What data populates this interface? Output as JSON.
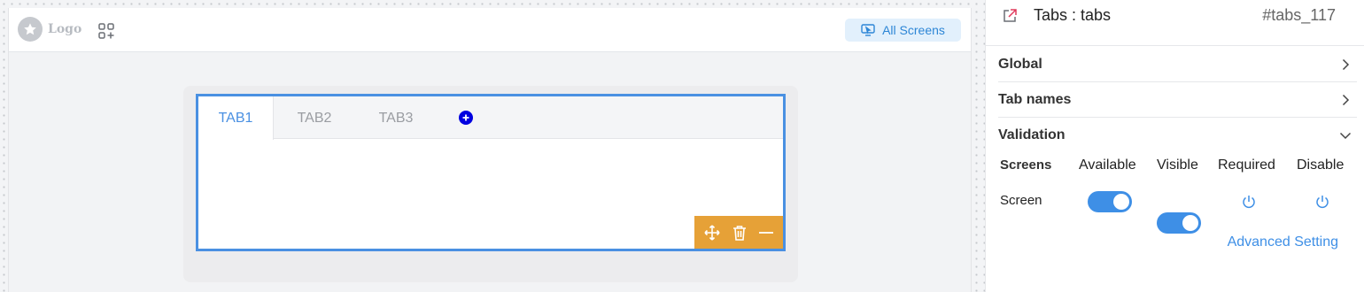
{
  "canvas": {
    "logo_text": "Logo",
    "all_screens_label": "All Screens",
    "tabs": [
      {
        "label": "TAB1",
        "active": true
      },
      {
        "label": "TAB2",
        "active": false
      },
      {
        "label": "TAB3",
        "active": false
      }
    ],
    "toolbar_color": "#e6a137",
    "selection_color": "#4a90e2"
  },
  "panel": {
    "title": "Tabs : tabs",
    "id": "#tabs_117",
    "sections": [
      {
        "label": "Global",
        "state": "collapsed"
      },
      {
        "label": "Tab names",
        "state": "collapsed"
      },
      {
        "label": "Validation",
        "state": "expanded"
      }
    ],
    "validation": {
      "headers": [
        "Screens",
        "Available",
        "Visible",
        "Required",
        "Disable"
      ],
      "rows": [
        {
          "screen": "Screen",
          "available": true,
          "visible": true,
          "required": false,
          "disable": false
        }
      ]
    },
    "advanced_setting": "Advanced Setting",
    "accent": "#3e8fe6"
  }
}
